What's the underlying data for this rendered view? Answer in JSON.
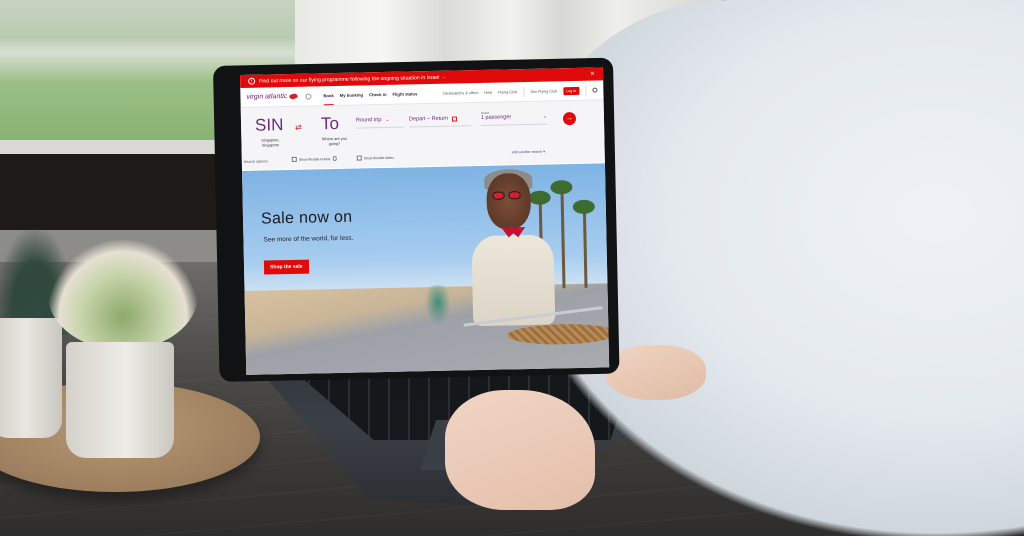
{
  "scene": {
    "description": "Photo of a person using a laptop on a desk, showing the Virgin Atlantic website",
    "colors": {
      "brand_red": "#e10a0a",
      "brand_purple": "#6b2a7c"
    }
  },
  "website": {
    "alert": {
      "icon": "info-circle-icon",
      "text": "Find out more on our flying programme following the ongoing situation in Israel →",
      "close_icon": "✕"
    },
    "nav": {
      "logo_text": "virgin atlantic",
      "items": [
        {
          "label": "Book",
          "active": true
        },
        {
          "label": "My booking",
          "active": false
        },
        {
          "label": "Check in",
          "active": false
        },
        {
          "label": "Flight status",
          "active": false
        }
      ],
      "secondary": [
        {
          "label": "Destinations & offers"
        },
        {
          "label": "Help"
        },
        {
          "label": "Flying Club"
        }
      ],
      "join_label": "Join Flying Club",
      "login_label": "Log in",
      "search_icon": "search-icon"
    },
    "booking": {
      "from_code": "SIN",
      "from_sub": "Singapore, Singapore",
      "swap_icon": "⇄",
      "to_code": "To",
      "to_sub": "Where are you going?",
      "trip_type": "Round trip",
      "dates": "Depart – Return",
      "pax_label": "Guest",
      "pax_value": "1 passenger",
      "go_icon": "→",
      "add_search": "Add another search ▾",
      "options_label": "Search options",
      "checkbox1": "Show flexible tickets",
      "checkbox2": "Show flexible dates"
    },
    "hero": {
      "title": "Sale now on",
      "subtitle": "See more of the world, for less.",
      "cta": "Shop the sale"
    }
  }
}
